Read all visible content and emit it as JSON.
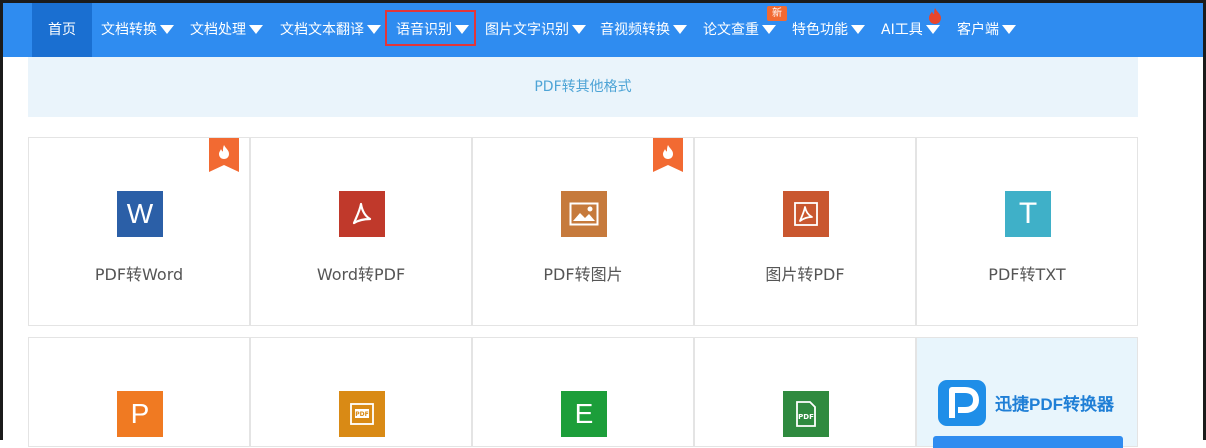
{
  "nav": {
    "home": "首页",
    "items": [
      "文档转换",
      "文档处理",
      "文档文本翻译",
      "语音识别",
      "图片文字识别",
      "音视频转换",
      "论文查重",
      "特色功能",
      "AI工具",
      "客户端"
    ],
    "new_badge": "新"
  },
  "subheader": "PDF转其他格式",
  "tiles_row1": [
    {
      "label": "PDF转Word",
      "icon": "word-icon",
      "color": "#2b5fa7",
      "hot": true
    },
    {
      "label": "Word转PDF",
      "icon": "acrobat-icon",
      "color": "#c0392b",
      "hot": false
    },
    {
      "label": "PDF转图片",
      "icon": "image-icon",
      "color": "#c67a3c",
      "hot": true
    },
    {
      "label": "图片转PDF",
      "icon": "acrobat-icon",
      "color": "#c9572f",
      "hot": false
    },
    {
      "label": "PDF转TXT",
      "icon": "text-icon",
      "color": "#3fb0c8",
      "hot": false
    }
  ],
  "tiles_row2": [
    {
      "icon": "powerpoint-icon",
      "color": "#f07a22"
    },
    {
      "icon": "pdf-document-icon",
      "color": "#d98a15"
    },
    {
      "icon": "excel-icon",
      "color": "#1c9e3a"
    },
    {
      "icon": "pdf-document-icon",
      "color": "#2f8a3f"
    }
  ],
  "promo": {
    "title": "迅捷PDF转换器"
  },
  "colors": {
    "nav_bg": "#2f8cf0",
    "nav_active": "#1a6fd1",
    "highlight": "#e3363a"
  }
}
